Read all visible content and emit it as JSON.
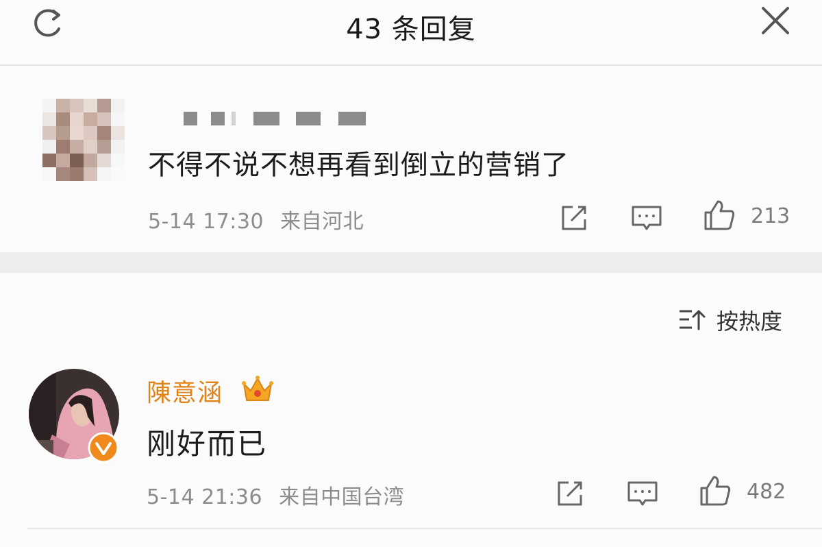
{
  "header": {
    "title": "43 条回复",
    "refresh_icon": "refresh-icon",
    "close_icon": "close-icon"
  },
  "top_comment": {
    "text": "不得不说不想再看到倒立的营销了",
    "date": "5-14 17:30",
    "location": "来自河北",
    "likes": "213"
  },
  "sort": {
    "label": "按热度",
    "icon": "sort-icon"
  },
  "reply": {
    "username": "陳意涵",
    "text": "刚好而已",
    "date": "5-14 21:36",
    "location": "来自中国台湾",
    "likes": "482",
    "colors": {
      "username": "#e0841a",
      "verify_badge": "#f08a1c"
    }
  }
}
